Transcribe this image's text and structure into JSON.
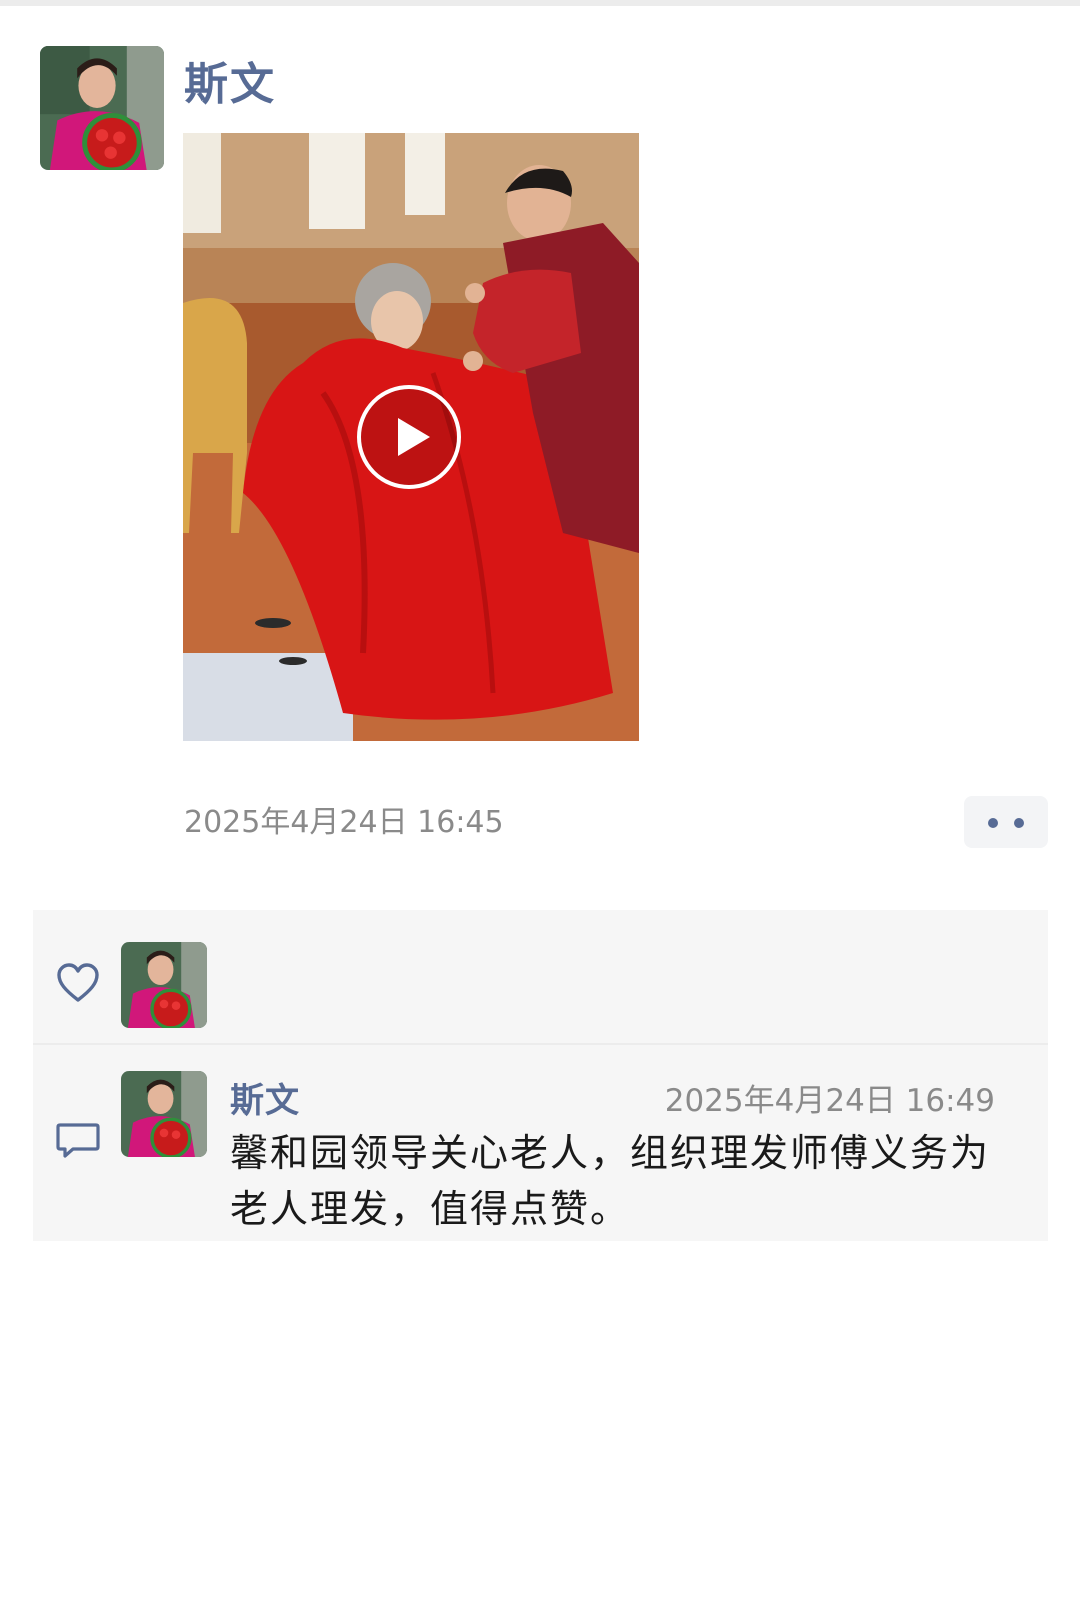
{
  "post": {
    "author_name": "斯文",
    "avatar_icon": "author-portrait-avatar",
    "media": {
      "type": "video",
      "play_icon": "play-icon"
    },
    "timestamp": "2025年4月24日 16:45",
    "more_icon": "more-dots-icon"
  },
  "interactions": {
    "like_icon": "heart-icon",
    "comment_icon": "comment-bubble-icon",
    "likes": [
      {
        "avatar_icon": "author-portrait-avatar"
      }
    ],
    "comments": [
      {
        "author": "斯文",
        "time": "2025年4月24日 16:49",
        "text": "馨和园领导关心老人，组织理发师傅义务为老人理发，值得点赞。"
      }
    ]
  },
  "colors": {
    "name_link": "#576b95",
    "muted_text": "#8a8a8a",
    "panel_bg": "#f6f6f6",
    "body_text": "#1a1a1a"
  }
}
